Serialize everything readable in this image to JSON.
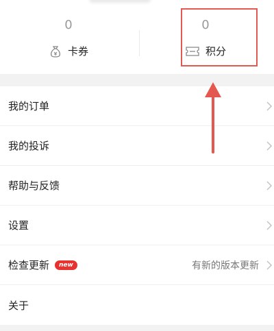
{
  "stats": {
    "coupons": {
      "value": "0",
      "label": "卡券",
      "icon": "coupon-bag-icon"
    },
    "points": {
      "value": "0",
      "label": "积分",
      "icon": "ticket-icon"
    }
  },
  "menu": {
    "items": [
      {
        "label": "我的订单"
      },
      {
        "label": "我的投诉"
      },
      {
        "label": "帮助与反馈"
      },
      {
        "label": "设置"
      },
      {
        "label": "检查更新",
        "badge": "new",
        "right_text": "有新的版本更新"
      },
      {
        "label": "关于"
      }
    ]
  },
  "colors": {
    "highlight": "#e3584f",
    "badge": "#e8322f"
  }
}
